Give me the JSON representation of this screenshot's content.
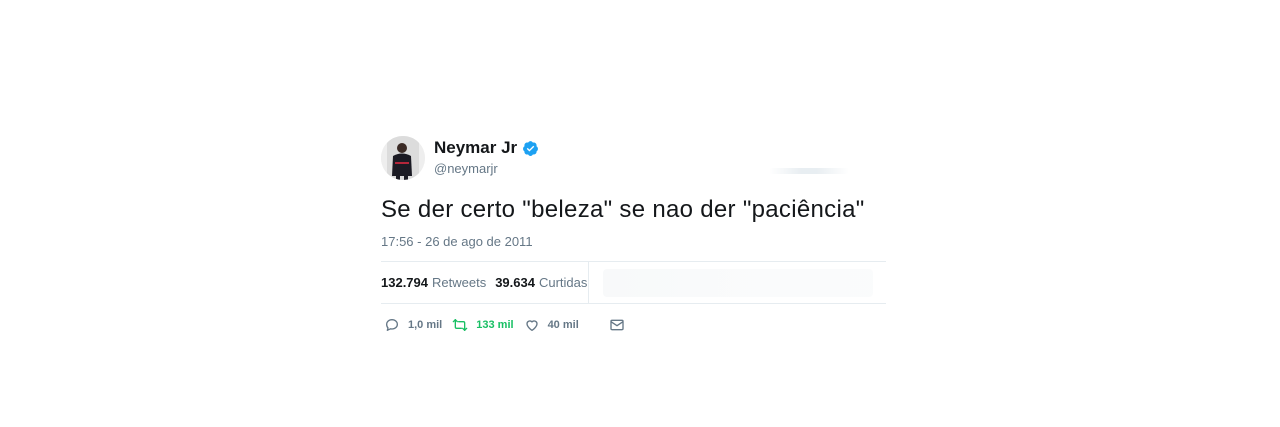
{
  "tweet": {
    "display_name": "Neymar Jr",
    "handle": "@neymarjr",
    "verified": true,
    "text": "Se der certo \"beleza\" se nao der \"paciência\"",
    "timestamp": "17:56 - 26 de ago de 2011",
    "stats": {
      "retweets_count": "132.794",
      "retweets_label": "Retweets",
      "likes_count": "39.634",
      "likes_label": "Curtidas"
    },
    "actions": {
      "reply_count": "1,0 mil",
      "retweet_count": "133 mil",
      "like_count": "40 mil"
    }
  },
  "icons": {
    "verified": "verified-badge-icon",
    "reply": "reply-icon",
    "retweet": "retweet-icon",
    "like": "heart-icon",
    "dm": "envelope-icon"
  },
  "colors": {
    "text": "#14171a",
    "muted": "#657786",
    "verified": "#1da1f2",
    "retweeted": "#17bf63",
    "divider": "#e6ecf0"
  }
}
